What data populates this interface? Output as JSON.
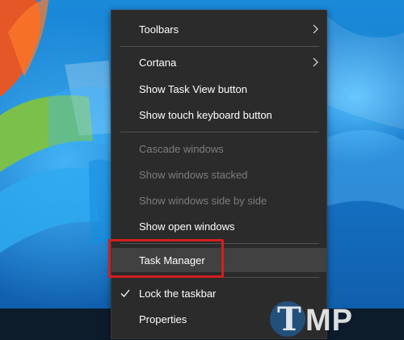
{
  "context_menu": {
    "items": [
      {
        "label": "Toolbars",
        "has_submenu": true,
        "enabled": true
      },
      {
        "label": "Cortana",
        "has_submenu": true,
        "enabled": true
      },
      {
        "label": "Show Task View button",
        "enabled": true
      },
      {
        "label": "Show touch keyboard button",
        "enabled": true
      },
      {
        "label": "Cascade windows",
        "enabled": false
      },
      {
        "label": "Show windows stacked",
        "enabled": false
      },
      {
        "label": "Show windows side by side",
        "enabled": false
      },
      {
        "label": "Show open windows",
        "enabled": true
      },
      {
        "label": "Task Manager",
        "enabled": true,
        "highlighted": true
      },
      {
        "label": "Lock the taskbar",
        "enabled": true,
        "checked": true
      },
      {
        "label": "Properties",
        "enabled": true
      }
    ]
  },
  "watermark": {
    "letter": "T",
    "text": "MP"
  },
  "colors": {
    "menu_background": "#2b2b2b",
    "highlight": "#414141",
    "disabled_text": "#7d7d7d",
    "callout_border": "#d21f1f",
    "desktop_blue": "#1a8ad9"
  },
  "icons": {
    "submenu": "chevron-right-icon",
    "checked": "checkmark-icon"
  }
}
